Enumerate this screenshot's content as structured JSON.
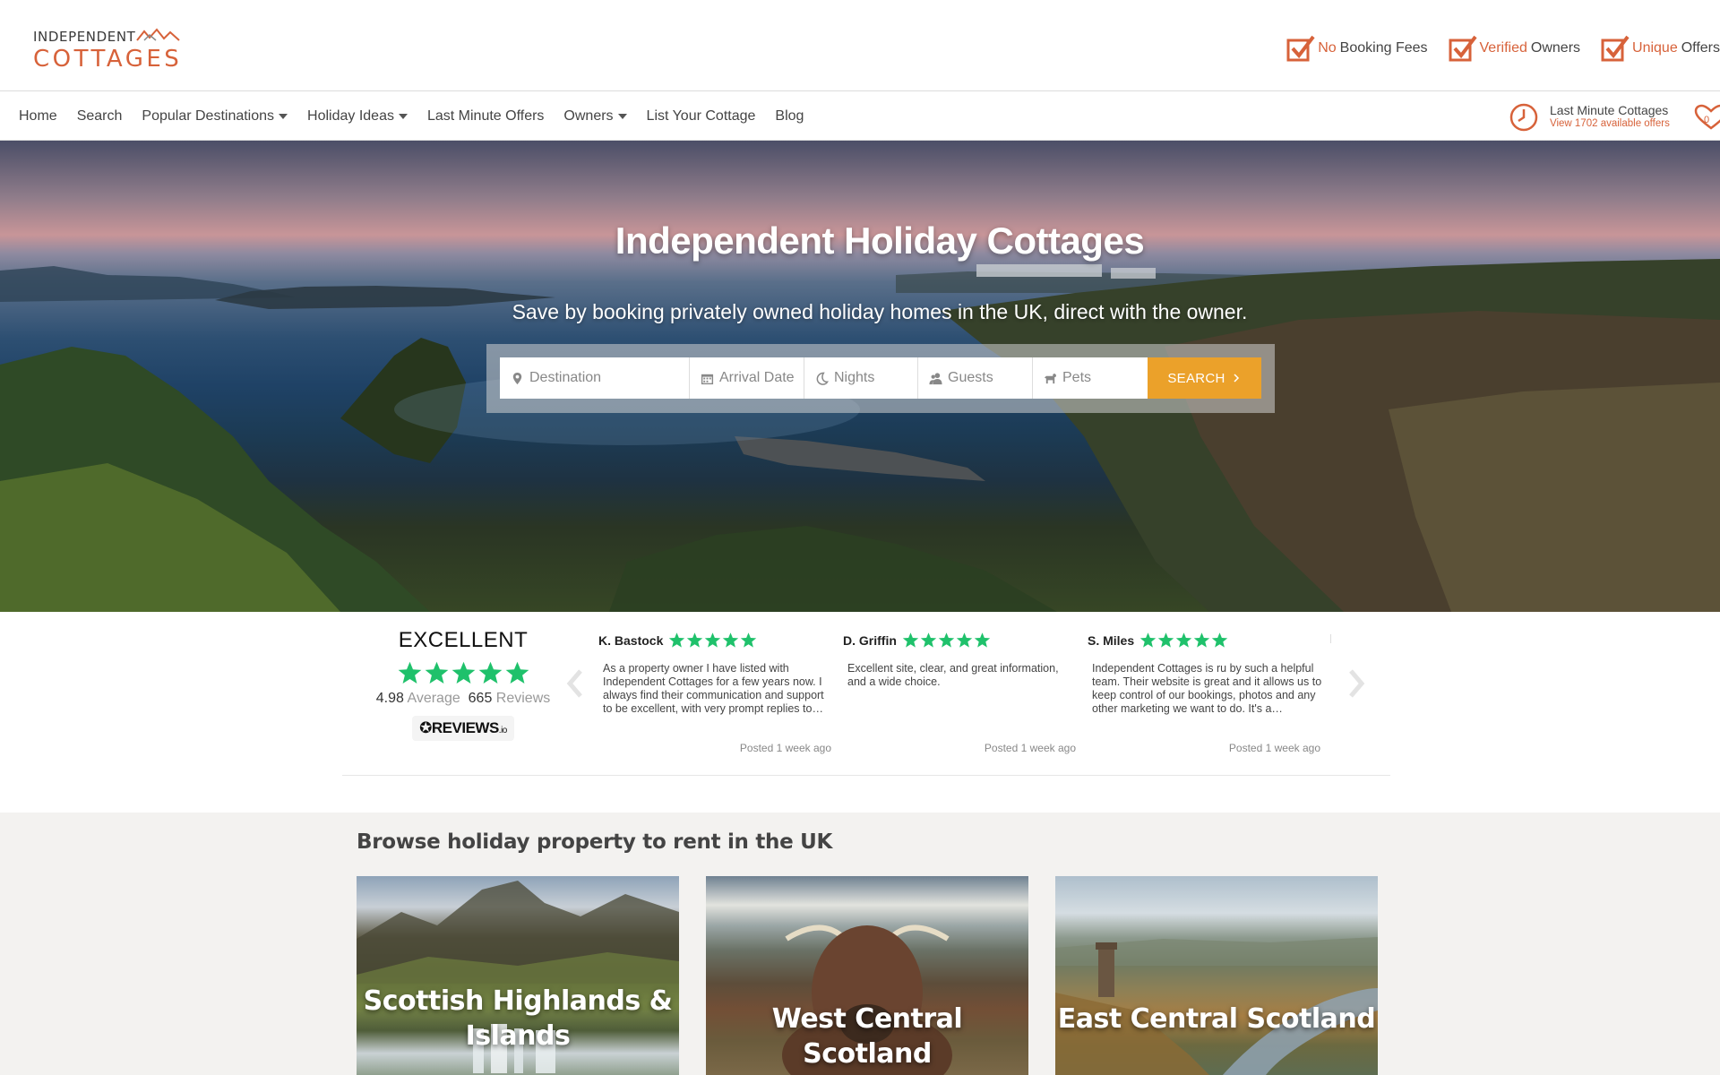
{
  "brand": {
    "logo_top": "INDEPENDENT",
    "logo_bottom": "COTTAGES",
    "accent": "#d7623a",
    "search_button_color": "#eba12a"
  },
  "usps": [
    {
      "highlight": "No",
      "text": "Booking Fees"
    },
    {
      "highlight": "Verified",
      "text": "Owners"
    },
    {
      "highlight": "Unique",
      "text": "Offers"
    }
  ],
  "nav": {
    "items": [
      {
        "label": "Home",
        "dropdown": false
      },
      {
        "label": "Search",
        "dropdown": false
      },
      {
        "label": "Popular Destinations",
        "dropdown": true
      },
      {
        "label": "Holiday Ideas",
        "dropdown": true
      },
      {
        "label": "Last Minute Offers",
        "dropdown": false
      },
      {
        "label": "Owners",
        "dropdown": true
      },
      {
        "label": "List Your Cottage",
        "dropdown": false
      },
      {
        "label": "Blog",
        "dropdown": false
      }
    ],
    "last_minute_title": "Last Minute Cottages",
    "last_minute_sub": "View 1702 available offers",
    "favourites_count": "0"
  },
  "hero": {
    "title": "Independent Holiday Cottages",
    "subtitle": "Save by booking privately owned holiday homes in the UK, direct with the owner.",
    "search": {
      "destination_placeholder": "Destination",
      "arrival_placeholder": "Arrival Date",
      "nights_placeholder": "Nights",
      "guests_placeholder": "Guests",
      "pets_placeholder": "Pets",
      "button_label": "SEARCH"
    }
  },
  "reviews": {
    "rating_word": "EXCELLENT",
    "average": "4.98",
    "average_label": "Average",
    "count": "665",
    "count_label": "Reviews",
    "provider": "REVIEWS",
    "provider_suffix": ".io",
    "star_color": "#1fc16b",
    "items": [
      {
        "author": "K. Bastock",
        "stars": 5,
        "text": "As a property owner I have listed with Independent Cottages for a few years now. I always find their communication and support to be excellent, with very prompt replies to…",
        "date": "Posted 1 week ago"
      },
      {
        "author": "D. Griffin",
        "stars": 5,
        "text": "Excellent site, clear, and great information, and a wide choice.",
        "date": "Posted 1 week ago"
      },
      {
        "author": "S. Miles",
        "stars": 5,
        "text": "Independent Cottages is ru by such a helpful team. Their website is great and it allows us to keep control of our bookings, photos and any other marketing we want to do. It's a…",
        "date": "Posted 1 week ago"
      }
    ]
  },
  "browse": {
    "title": "Browse holiday property to rent in the UK",
    "regions": [
      {
        "name": "Scottish Highlands & Islands"
      },
      {
        "name": "West Central Scotland"
      },
      {
        "name": "East Central Scotland"
      }
    ]
  }
}
